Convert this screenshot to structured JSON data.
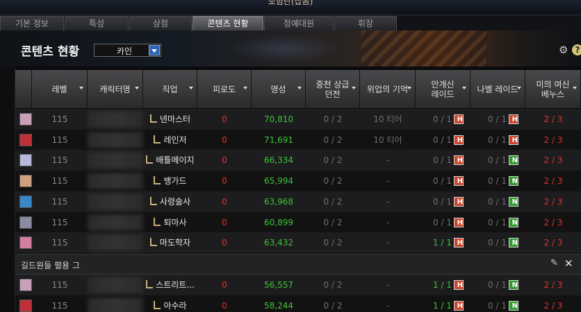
{
  "window": {
    "title": "모험단(삽음)"
  },
  "tabs": [
    {
      "label": "기본 정보",
      "active": false
    },
    {
      "label": "특성",
      "active": false
    },
    {
      "label": "상점",
      "active": false
    },
    {
      "label": "콘텐츠 현황",
      "active": true
    },
    {
      "label": "정예대원",
      "active": false
    },
    {
      "label": "휘장",
      "active": false
    }
  ],
  "header": {
    "title": "콘텐츠 현황",
    "character_select": "카인",
    "help_label": "?"
  },
  "columns": [
    "레벨",
    "캐릭터명",
    "직업",
    "피로도",
    "명성",
    "중천 상급\n던전",
    "위업의 기억",
    "안개신\n레이드",
    "나벨 레이드",
    "미의 여신\n베누스"
  ],
  "rows": [
    {
      "level": "115",
      "job": "넨마스터",
      "fatigue": "0",
      "fame": "70,810",
      "dungeon": "0 / 2",
      "feat": "10 티어",
      "fog": "0 / 1",
      "fog_badge": "H",
      "nabel": "0 / 1",
      "nabel_badge": "H",
      "venus": "2 / 3"
    },
    {
      "level": "115",
      "job": "레인저",
      "fatigue": "0",
      "fame": "71,691",
      "dungeon": "0 / 2",
      "feat": "10 티어",
      "fog": "0 / 1",
      "fog_badge": "H",
      "nabel": "0 / 1",
      "nabel_badge": "H",
      "venus": "2 / 3"
    },
    {
      "level": "115",
      "job": "배틀메이지",
      "fatigue": "0",
      "fame": "66,334",
      "dungeon": "0 / 2",
      "feat": "-",
      "fog": "0 / 1",
      "fog_badge": "H",
      "nabel": "0 / 1",
      "nabel_badge": "N",
      "venus": "2 / 3"
    },
    {
      "level": "115",
      "job": "뱅가드",
      "fatigue": "0",
      "fame": "65,994",
      "dungeon": "0 / 2",
      "feat": "-",
      "fog": "0 / 1",
      "fog_badge": "H",
      "nabel": "0 / 1",
      "nabel_badge": "N",
      "venus": "2 / 3"
    },
    {
      "level": "115",
      "job": "사령술사",
      "fatigue": "0",
      "fame": "63,968",
      "dungeon": "0 / 2",
      "feat": "-",
      "fog": "0 / 1",
      "fog_badge": "H",
      "nabel": "0 / 1",
      "nabel_badge": "N",
      "venus": "2 / 3"
    },
    {
      "level": "115",
      "job": "퇴마사",
      "fatigue": "0",
      "fame": "60,899",
      "dungeon": "0 / 2",
      "feat": "-",
      "fog": "0 / 1",
      "fog_badge": "H",
      "nabel": "0 / 1",
      "nabel_badge": "N",
      "venus": "2 / 3"
    },
    {
      "level": "115",
      "job": "마도학자",
      "fatigue": "0",
      "fame": "63,432",
      "dungeon": "0 / 2",
      "feat": "-",
      "fog": "1 / 1",
      "fog_badge": "H",
      "nabel": "0 / 1",
      "nabel_badge": "N",
      "venus": "2 / 3"
    }
  ],
  "group": {
    "name": "길드원들 펼용 그"
  },
  "group_rows": [
    {
      "level": "115",
      "job": "스트리트...",
      "fatigue": "0",
      "fame": "56,557",
      "dungeon": "0 / 2",
      "feat": "-",
      "fog": "1 / 1",
      "fog_badge": "H",
      "nabel": "0 / 1",
      "nabel_badge": "N",
      "venus": "2 / 3"
    },
    {
      "level": "115",
      "job": "아수라",
      "fatigue": "0",
      "fame": "58,244",
      "dungeon": "0 / 2",
      "feat": "-",
      "fog": "1 / 1",
      "fog_badge": "H",
      "nabel": "0 / 1",
      "nabel_badge": "N",
      "venus": "2 / 3"
    }
  ],
  "colors": {
    "fatigue": "#e0332b",
    "fame": "#3ec437",
    "venus": "#e0332b",
    "badge_h": "#c9452c",
    "badge_n": "#2e9b2c"
  }
}
